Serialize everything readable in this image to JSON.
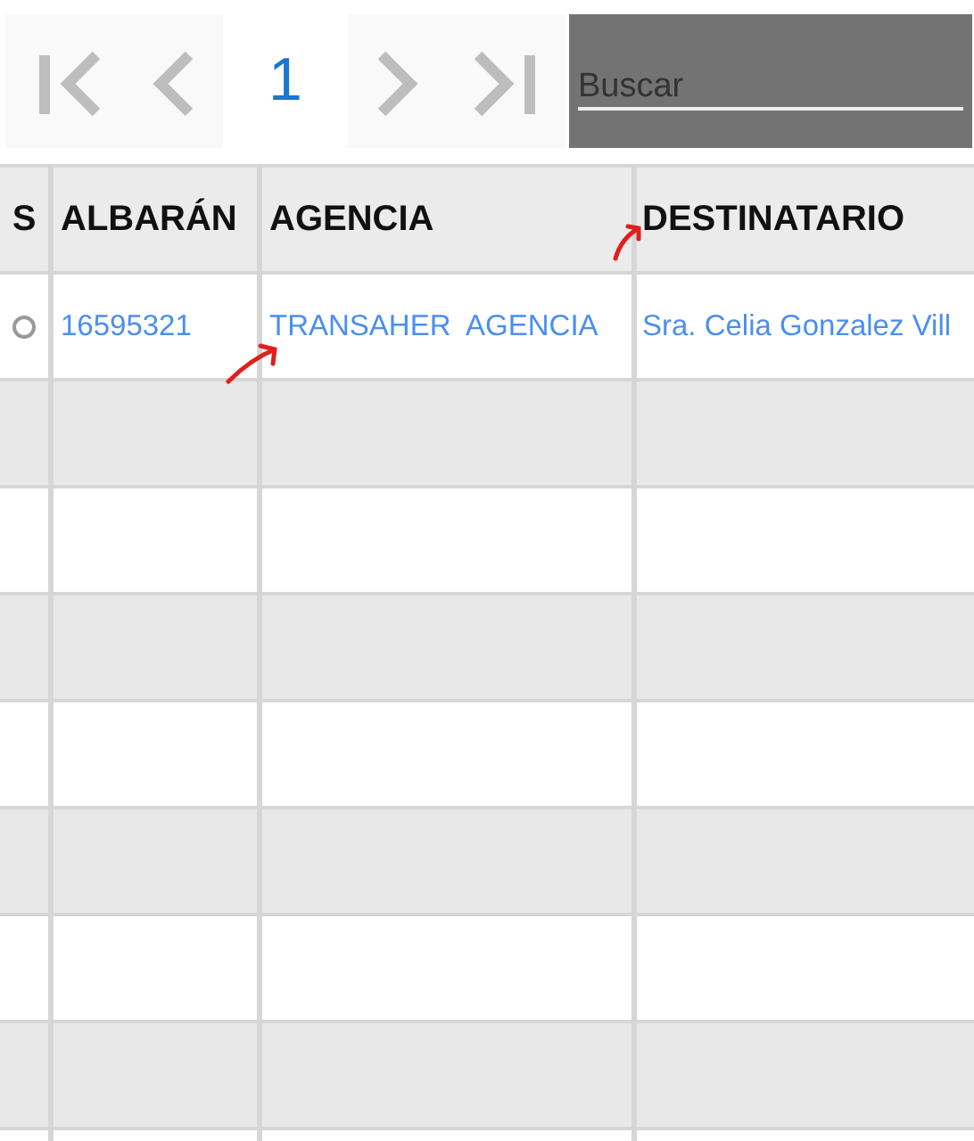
{
  "pager": {
    "page": "1"
  },
  "search": {
    "placeholder": "Buscar"
  },
  "table": {
    "columns": [
      "S",
      "ALBARÁN",
      "AGENCIA",
      "DESTINATARIO"
    ],
    "rows": [
      {
        "selected": false,
        "albaran": "16595321",
        "agencia": "TRANSAHER  AGENCIA",
        "destinatario": "Sra. Celia Gonzalez Vill"
      },
      {},
      {},
      {},
      {},
      {},
      {},
      {},
      {}
    ]
  }
}
